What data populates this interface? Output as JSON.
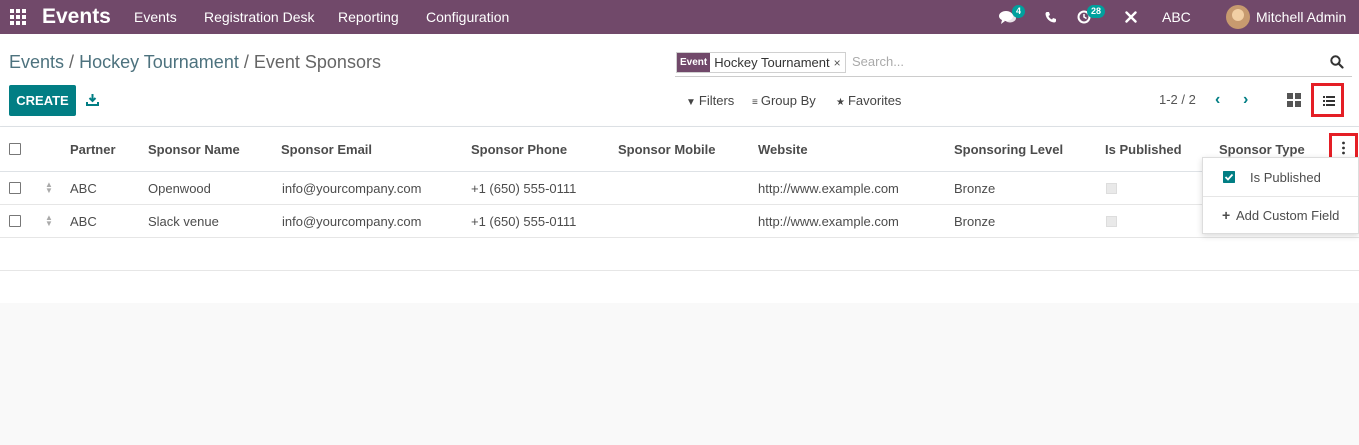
{
  "navbar": {
    "brand": "Events",
    "menu": [
      "Events",
      "Registration Desk",
      "Reporting",
      "Configuration"
    ],
    "messages_count": "4",
    "activities_count": "28",
    "company": "ABC",
    "user": "Mitchell Admin"
  },
  "breadcrumb": {
    "items": [
      "Events",
      "Hockey Tournament",
      "Event Sponsors"
    ],
    "separator": "/"
  },
  "search": {
    "facet_label": "Event",
    "facet_value": "Hockey Tournament",
    "facet_remove": "×",
    "placeholder": "Search..."
  },
  "actions": {
    "create_label": "CREATE"
  },
  "filters": {
    "filters_label": "Filters",
    "groupby_label": "Group By",
    "favorites_label": "Favorites"
  },
  "pager": {
    "value": "1-2 / 2"
  },
  "table": {
    "columns": [
      "Partner",
      "Sponsor Name",
      "Sponsor Email",
      "Sponsor Phone",
      "Sponsor Mobile",
      "Website",
      "Sponsoring Level",
      "Is Published",
      "Sponsor Type"
    ],
    "rows": [
      {
        "partner": "ABC",
        "name": "Openwood",
        "email": "info@yourcompany.com",
        "phone": "+1 (650) 555-0111",
        "mobile": "",
        "website": "http://www.example.com",
        "level": "Bronze",
        "published": false,
        "type": ""
      },
      {
        "partner": "ABC",
        "name": "Slack venue",
        "email": "info@yourcompany.com",
        "phone": "+1 (650) 555-0111",
        "mobile": "",
        "website": "http://www.example.com",
        "level": "Bronze",
        "published": false,
        "type": ""
      }
    ]
  },
  "optional_columns": {
    "items": [
      {
        "label": "Is Published",
        "checked": true
      }
    ],
    "add_custom_field": "Add Custom Field"
  },
  "colors": {
    "navbar": "#71496a",
    "primary": "#017e84",
    "highlight": "#e41e25"
  }
}
